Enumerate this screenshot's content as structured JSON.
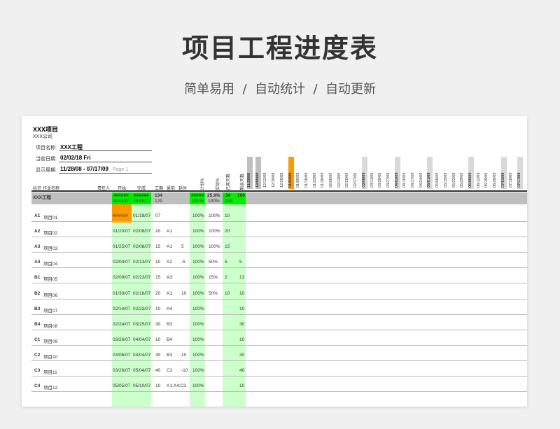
{
  "page_title": "项目工程进度表",
  "page_subtitle": "简单易用  /  自动统计  /  自动更新",
  "sheet": {
    "project": "XXX项目",
    "company": "XXX公司",
    "info": [
      {
        "label": "项目名称:",
        "value": "XXX工程",
        "extra": ""
      },
      {
        "label": "当前日期:",
        "value": "02/02/18 Fri",
        "extra": ""
      },
      {
        "label": "显示周期:",
        "value": "11/28/08 - 07/17/09",
        "extra": "Page 1"
      }
    ],
    "headers": {
      "id": "标识",
      "name": "作业名称",
      "owner": "责任人",
      "start": "开始",
      "finish": "完成",
      "duration": "工期",
      "pred": "紧前",
      "lag": "延时",
      "plan_pct": "计划%",
      "actual_pct": "实际%",
      "elapsed": "已用天数",
      "remaining": "剩余天数"
    },
    "dates": [
      "11/28/08",
      "12/05/08",
      "12/12/08",
      "12/19/08",
      "12/26/08",
      "01/02/09",
      "01/09/09",
      "01/16/09",
      "01/23/09",
      "01/30/09",
      "02/06/09",
      "02/13/09",
      "02/20/09",
      "02/27/09",
      "03/06/09",
      "03/13/09",
      "03/20/09",
      "03/27/09",
      "04/03/09",
      "04/10/09",
      "04/17/09",
      "04/24/09",
      "05/01/09",
      "05/08/09",
      "05/15/09",
      "05/22/09",
      "05/29/09",
      "06/05/09",
      "06/12/09",
      "06/19/09",
      "06/26/09",
      "07/03/09",
      "07/10/09",
      "07/17/09"
    ],
    "summary": {
      "name": "XXX工程",
      "start": "######",
      "finish": "######",
      "duration": "134",
      "plan": "#####",
      "actual": "25.9%",
      "elapsed": "34",
      "remaining": "100",
      "start2": "01/01/07",
      "finish2": "05/10/07",
      "duration2": "129",
      "plan2": "100%",
      "actual2": "100%",
      "elapsed2": "129"
    },
    "rows": [
      {
        "id": "A1",
        "name": "项目01",
        "start": "######",
        "finish": "01/19/07",
        "dur": "07",
        "pred": "",
        "lag": "",
        "plan": "100%",
        "actual": "100%",
        "elapsed": "10",
        "remaining": ""
      },
      {
        "id": "A2",
        "name": "项目02",
        "start": "01/20/07",
        "finish": "02/08/07",
        "dur": "20",
        "pred": "A1",
        "lag": "",
        "plan": "100%",
        "actual": "100%",
        "elapsed": "20",
        "remaining": ""
      },
      {
        "id": "A3",
        "name": "项目03",
        "start": "01/25/07",
        "finish": "02/08/07",
        "dur": "15",
        "pred": "A1",
        "lag": "5",
        "plan": "100%",
        "actual": "100%",
        "elapsed": "15",
        "remaining": ""
      },
      {
        "id": "A4",
        "name": "项目04",
        "start": "02/04/07",
        "finish": "02/13/07",
        "dur": "10",
        "pred": "A2",
        "lag": "-5",
        "plan": "100%",
        "actual": "50%",
        "elapsed": "5",
        "remaining": "5"
      },
      {
        "id": "B1",
        "name": "项目05",
        "start": "02/09/07",
        "finish": "02/23/07",
        "dur": "15",
        "pred": "A3",
        "lag": "",
        "plan": "100%",
        "actual": "15%",
        "elapsed": "2",
        "remaining": "13"
      },
      {
        "id": "B2",
        "name": "项目06",
        "start": "01/30/07",
        "finish": "02/18/07",
        "dur": "20",
        "pred": "A1",
        "lag": "10",
        "plan": "100%",
        "actual": "50%",
        "elapsed": "10",
        "remaining": "10"
      },
      {
        "id": "B3",
        "name": "项目07",
        "start": "02/14/07",
        "finish": "02/23/07",
        "dur": "10",
        "pred": "A4",
        "lag": "",
        "plan": "100%",
        "actual": "",
        "elapsed": "",
        "remaining": "10"
      },
      {
        "id": "B4",
        "name": "项目08",
        "start": "02/24/07",
        "finish": "03/25/07",
        "dur": "30",
        "pred": "B3",
        "lag": "",
        "plan": "100%",
        "actual": "",
        "elapsed": "",
        "remaining": "30"
      },
      {
        "id": "C1",
        "name": "项目09",
        "start": "03/26/07",
        "finish": "04/04/07",
        "dur": "10",
        "pred": "B4",
        "lag": "",
        "plan": "100%",
        "actual": "",
        "elapsed": "",
        "remaining": "10"
      },
      {
        "id": "C2",
        "name": "项目10",
        "start": "03/06/07",
        "finish": "04/04/07",
        "dur": "30",
        "pred": "B3",
        "lag": "10",
        "plan": "100%",
        "actual": "",
        "elapsed": "",
        "remaining": "30"
      },
      {
        "id": "C3",
        "name": "项目11",
        "start": "03/26/07",
        "finish": "05/04/07",
        "dur": "40",
        "pred": "C2",
        "lag": "-10",
        "plan": "100%",
        "actual": "",
        "elapsed": "",
        "remaining": "40"
      },
      {
        "id": "C4",
        "name": "项目12",
        "start": "05/05/07",
        "finish": "05/10/07",
        "dur": "10",
        "pred": "A1;A4;C3",
        "lag": "",
        "plan": "100%",
        "actual": "",
        "elapsed": "",
        "remaining": "10"
      }
    ],
    "colors": {
      "green": "#ccffcc",
      "bright_green": "#00ee00",
      "orange": "#ff9900",
      "gray": "#bfbfbf"
    }
  }
}
